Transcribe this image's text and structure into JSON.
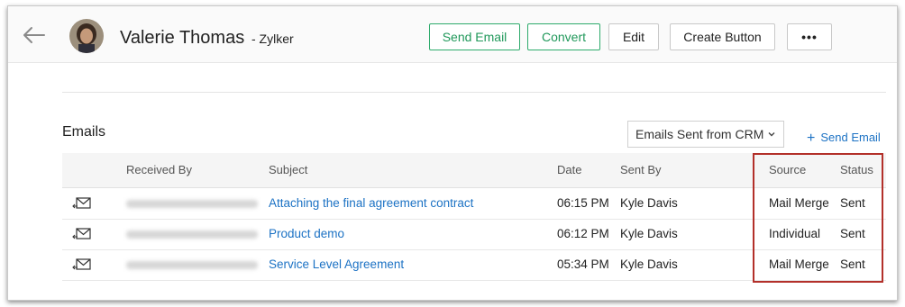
{
  "header": {
    "contact_name": "Valerie Thomas",
    "company": "- Zylker",
    "buttons": {
      "send_email": "Send Email",
      "convert": "Convert",
      "edit": "Edit",
      "create_button": "Create Button",
      "more": "•••"
    }
  },
  "emails": {
    "title": "Emails",
    "filter_value": "Emails Sent from CRM",
    "send_email_link": "Send Email",
    "columns": [
      "Received By",
      "Subject",
      "Date",
      "Sent By",
      "Source",
      "Status"
    ],
    "rows": [
      {
        "subject": "Attaching the final agreement contract",
        "date": "06:15 PM",
        "sent_by": "Kyle Davis",
        "source": "Mail Merge",
        "status": "Sent"
      },
      {
        "subject": "Product demo",
        "date": "06:12 PM",
        "sent_by": "Kyle Davis",
        "source": "Individual",
        "status": "Sent"
      },
      {
        "subject": "Service Level Agreement",
        "date": "05:34 PM",
        "sent_by": "Kyle Davis",
        "source": "Mail Merge",
        "status": "Sent"
      }
    ]
  },
  "colors": {
    "accent_green": "#20985a",
    "link_blue": "#1c72c4",
    "highlight_red": "#b3302a"
  },
  "icons": [
    "back-arrow-icon",
    "avatar",
    "chevron-down-icon",
    "plus-icon",
    "mail-sent-icon"
  ]
}
